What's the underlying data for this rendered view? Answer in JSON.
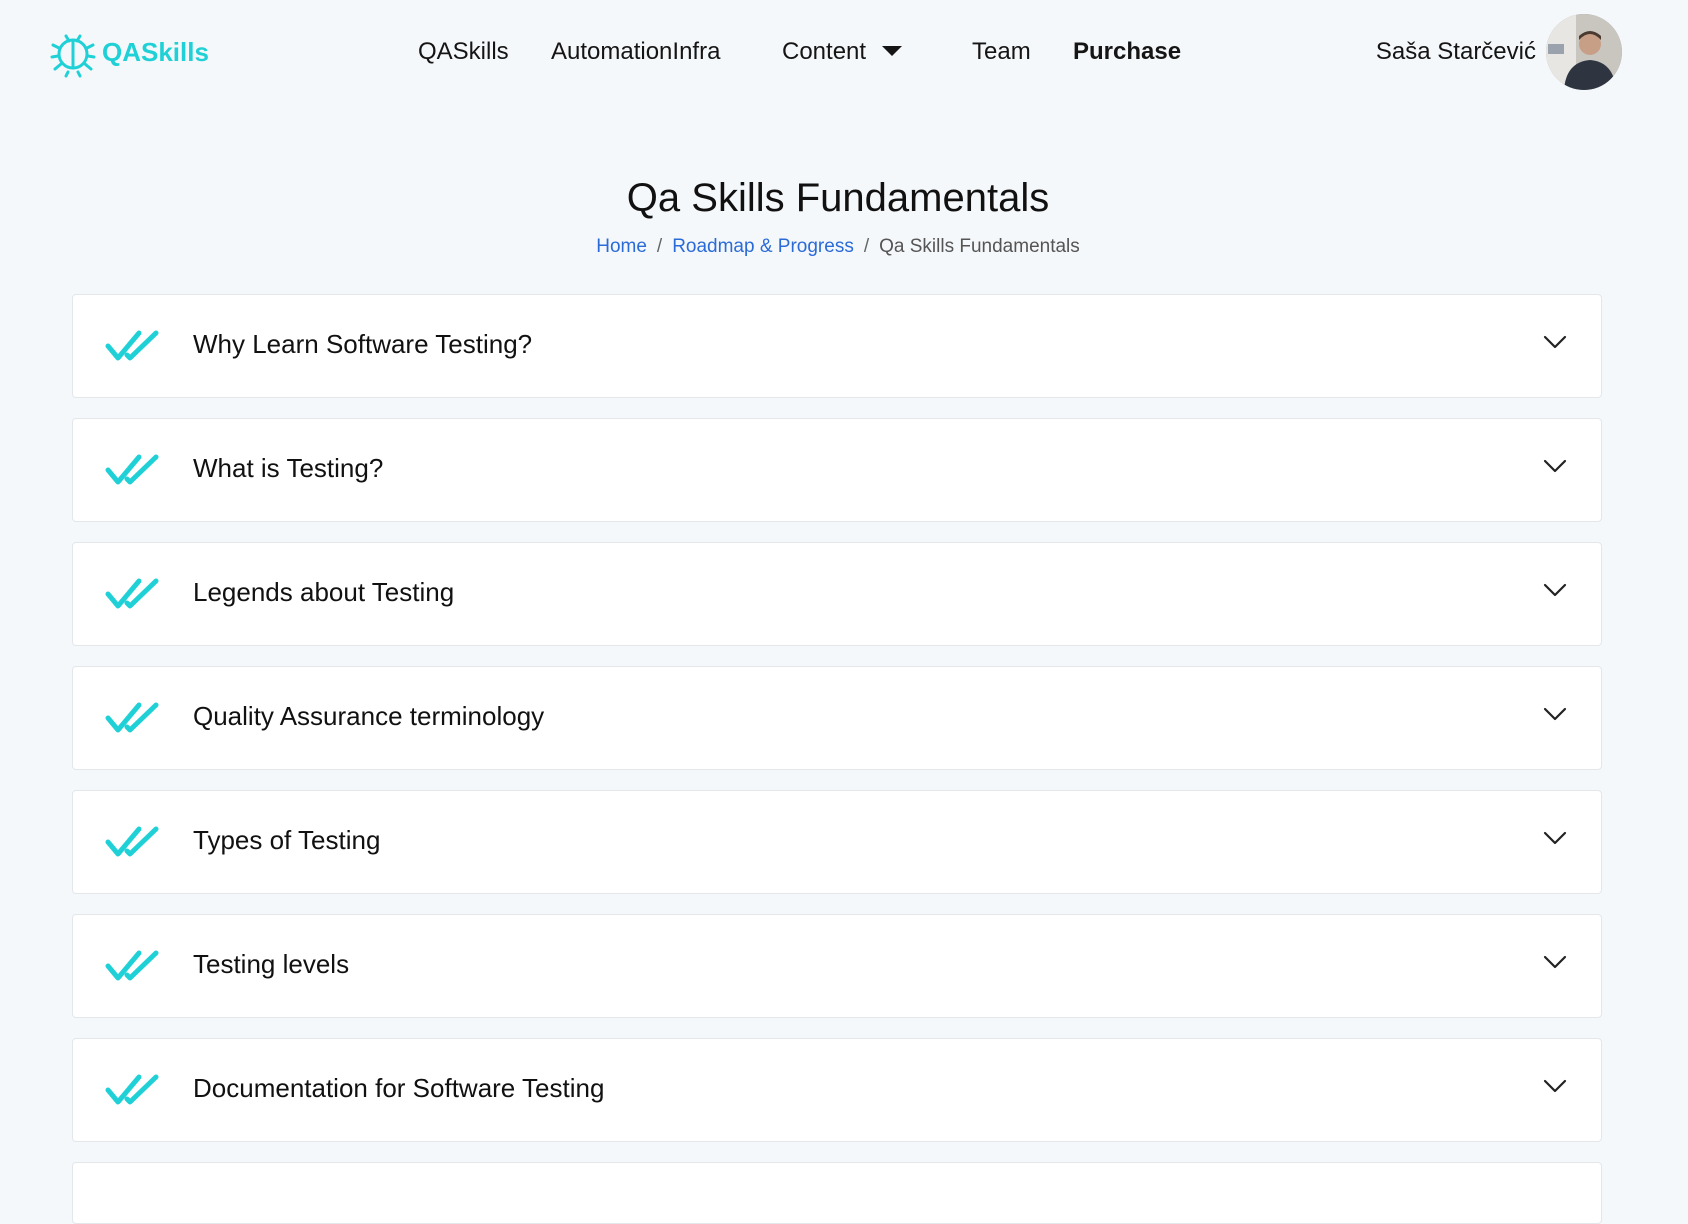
{
  "brand": {
    "name": "QASkills",
    "accent_color": "#1fd1d6"
  },
  "nav": {
    "items": [
      {
        "label": "QASkills"
      },
      {
        "label": "AutomationInfra"
      },
      {
        "label": "Content"
      },
      {
        "label": "Team"
      },
      {
        "label": "Purchase"
      }
    ]
  },
  "user": {
    "name": "Saša Starčević"
  },
  "page": {
    "title": "Qa Skills Fundamentals"
  },
  "breadcrumb": {
    "home": "Home",
    "roadmap": "Roadmap & Progress",
    "current": "Qa Skills Fundamentals",
    "separator": "/"
  },
  "sections": [
    {
      "title": "Why Learn Software Testing?",
      "completed": true
    },
    {
      "title": "What is Testing?",
      "completed": true
    },
    {
      "title": "Legends about Testing",
      "completed": true
    },
    {
      "title": "Quality Assurance terminology",
      "completed": true
    },
    {
      "title": "Types of Testing",
      "completed": true
    },
    {
      "title": "Testing levels",
      "completed": true
    },
    {
      "title": "Documentation for Software Testing",
      "completed": true
    }
  ],
  "icons": {
    "logo": "bug-gear-icon",
    "completed": "double-check-icon",
    "expand": "chevron-down-icon",
    "dropdown": "caret-down-icon"
  }
}
